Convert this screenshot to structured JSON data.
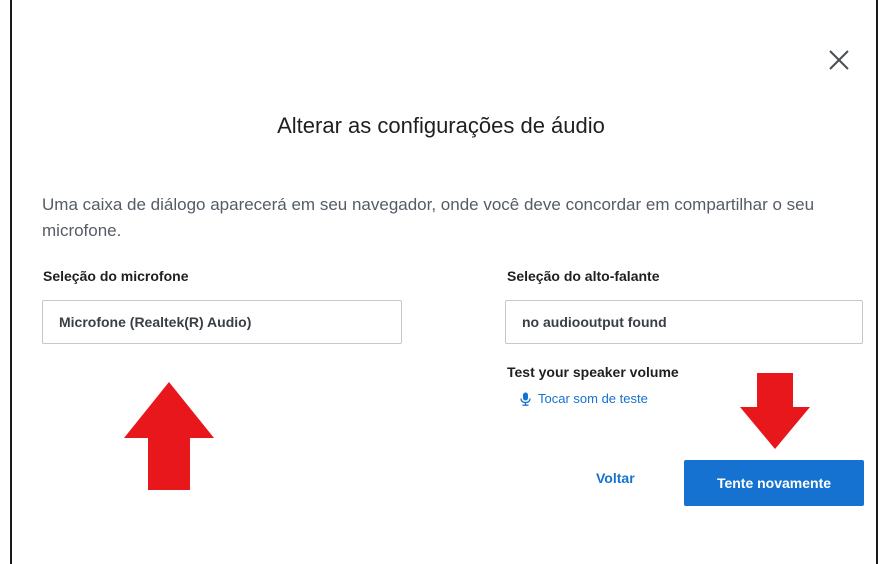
{
  "dialog": {
    "title": "Alterar as configurações de áudio",
    "description": "Uma caixa de diálogo aparecerá em seu navegador, onde você deve concordar em compartilhar o seu microfone.",
    "close_icon": "close-icon"
  },
  "microphone": {
    "label": "Seleção do microfone",
    "selected": "Microfone (Realtek(R) Audio)"
  },
  "speaker": {
    "label": "Seleção do alto-falante",
    "selected": "no audiooutput found",
    "test_label": "Test your speaker volume",
    "test_link": "Tocar som de teste",
    "test_icon": "microphone-icon"
  },
  "actions": {
    "back_label": "Voltar",
    "retry_label": "Tente novamente"
  },
  "colors": {
    "accent": "#1672d0",
    "annotation_arrow": "#e8171b"
  }
}
